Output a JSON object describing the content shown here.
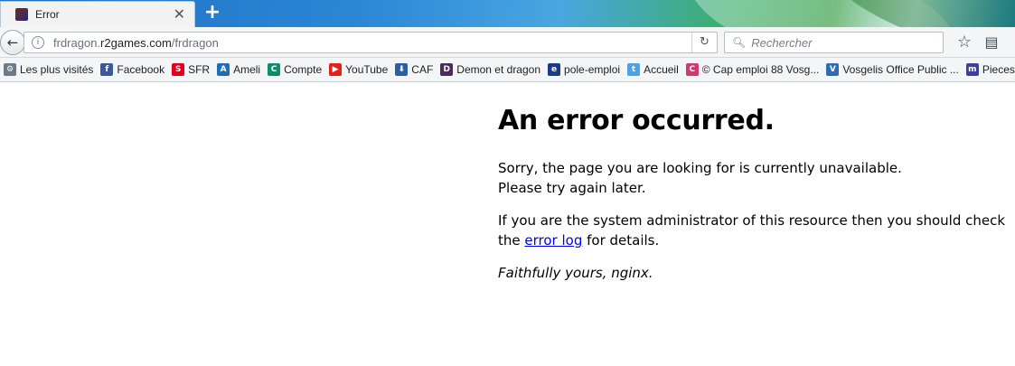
{
  "tab": {
    "title": "Error",
    "close_glyph": "✕",
    "new_tab_glyph": "+"
  },
  "navbar": {
    "back_glyph": "←",
    "url_host_prefix": "frdragon.",
    "url_host_main": "r2games.com",
    "url_path": "/frdragon",
    "reload_glyph": "↻",
    "search_placeholder": "Rechercher",
    "star_glyph": "☆",
    "list_glyph": "▤"
  },
  "bookmarks": {
    "items": [
      {
        "label": "Les plus visités",
        "icon": "gear-icon",
        "color": "#6b7a88",
        "glyph": "⚙"
      },
      {
        "label": "Facebook",
        "icon": "facebook-icon",
        "color": "#3b5998",
        "glyph": "f"
      },
      {
        "label": "SFR",
        "icon": "sfr-icon",
        "color": "#e2001a",
        "glyph": "S"
      },
      {
        "label": "Ameli",
        "icon": "ameli-icon",
        "color": "#1f6fb6",
        "glyph": "A"
      },
      {
        "label": "Compte",
        "icon": "bank-icon",
        "color": "#0f8c6e",
        "glyph": "C"
      },
      {
        "label": "YouTube",
        "icon": "youtube-icon",
        "color": "#e62117",
        "glyph": "▶"
      },
      {
        "label": "CAF",
        "icon": "caf-icon",
        "color": "#2a5fa8",
        "glyph": "⬇"
      },
      {
        "label": "Demon et dragon",
        "icon": "game-icon",
        "color": "#4a2b5c",
        "glyph": "D"
      },
      {
        "label": "pole-emploi",
        "icon": "pole-emploi-icon",
        "color": "#1a3a8a",
        "glyph": "e"
      },
      {
        "label": "Accueil",
        "icon": "twitter-icon",
        "color": "#4aa3e8",
        "glyph": "t"
      },
      {
        "label": "© Cap emploi 88 Vosg...",
        "icon": "cap-emploi-icon",
        "color": "#d23a6e",
        "glyph": "C"
      },
      {
        "label": "Vosgelis Office Public ...",
        "icon": "vosgelis-icon",
        "color": "#2e6db3",
        "glyph": "V"
      },
      {
        "label": "Pieces",
        "icon": "m-icon",
        "color": "#3c3f9e",
        "glyph": "m"
      }
    ]
  },
  "page": {
    "heading": "An error occurred.",
    "line1": "Sorry, the page you are looking for is currently unavailable.",
    "line2": "Please try again later.",
    "admin_text_before": "If you are the system administrator of this resource then you should check the",
    "link_text": "error log",
    "admin_text_after": " for details.",
    "signature": "Faithfully yours, nginx."
  }
}
